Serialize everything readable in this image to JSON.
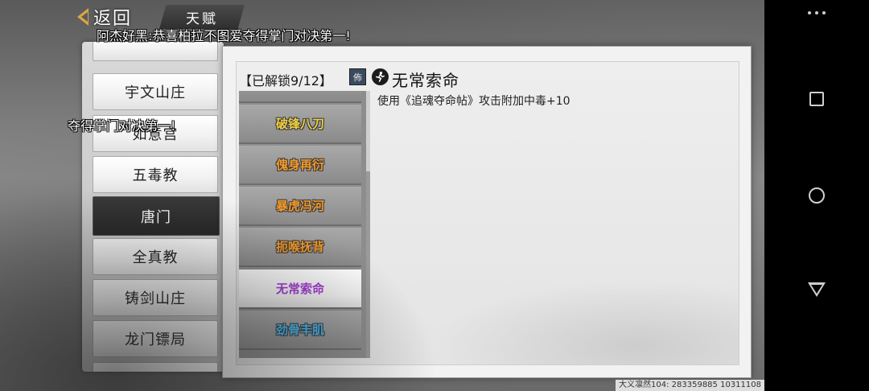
{
  "nav": {
    "back_label": "返回",
    "title": "天赋"
  },
  "marquee": {
    "message_1": "阿杰好黑:恭喜柏拉不图爱夺得掌门对决第一!",
    "message_2": "夺得掌门对决第一!"
  },
  "sects": [
    {
      "label": "宇文山庄",
      "active": false
    },
    {
      "label": "如意宫",
      "active": false
    },
    {
      "label": "五毒教",
      "active": false
    },
    {
      "label": "唐门",
      "active": true
    },
    {
      "label": "全真教",
      "active": false
    },
    {
      "label": "铸剑山庄",
      "active": false
    },
    {
      "label": "龙门镖局",
      "active": false
    }
  ],
  "panel": {
    "unlock_label": "【已解锁9/12】",
    "type_badge": "佈",
    "selected_title": "无常索命",
    "description": "使用《追魂夺命帖》攻击附加中毒+10"
  },
  "talents": [
    {
      "label": "破锋八刀",
      "color": "#f0d040",
      "selected": false
    },
    {
      "label": "傀身再衍",
      "color": "#f39a2a",
      "selected": false
    },
    {
      "label": "暴虎冯河",
      "color": "#f39a2a",
      "selected": false
    },
    {
      "label": "扼喉抚背",
      "color": "#f39a2a",
      "selected": false
    },
    {
      "label": "无常索命",
      "color": "#a23ad0",
      "selected": true
    },
    {
      "label": "劲骨丰肌",
      "color": "#4ab8f0",
      "selected": false
    }
  ],
  "id_strip": "大义凛然104: 283359885 10311108",
  "icons": {
    "back": "chevron-left-icon",
    "skill": "running-figure-icon",
    "android_menu": "more-dots-icon",
    "android_recent": "square-icon",
    "android_home": "circle-icon",
    "android_back": "triangle-icon"
  }
}
